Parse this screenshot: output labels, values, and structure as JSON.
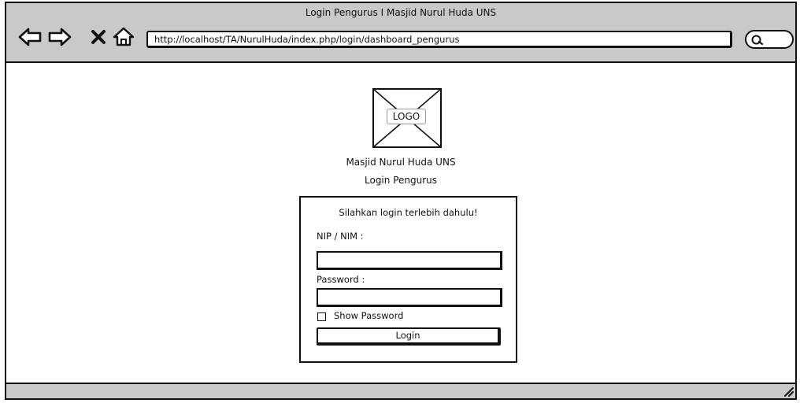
{
  "window": {
    "title": "Login Pengurus I Masjid Nurul Huda UNS"
  },
  "toolbar": {
    "url": "http://localhost/TA/NurulHuda/index.php/login/dashboard_pengurus",
    "icons": [
      "back-arrow-icon",
      "forward-arrow-icon",
      "close-icon",
      "home-icon",
      "search-icon"
    ]
  },
  "header": {
    "logo_label": "LOGO",
    "site_name": "Masjid Nurul Huda UNS",
    "page_heading": "Login Pengurus"
  },
  "login_form": {
    "message": "Silahkan login terlebih dahulu!",
    "nip_label": "NIP / NIM :",
    "nip_value": "",
    "password_label": "Password :",
    "password_value": "",
    "show_password_label": "Show Password",
    "show_password_checked": false,
    "submit_label": "Login"
  },
  "colors": {
    "chrome": "#c9c9c9",
    "border": "#111111",
    "background": "#ffffff"
  }
}
